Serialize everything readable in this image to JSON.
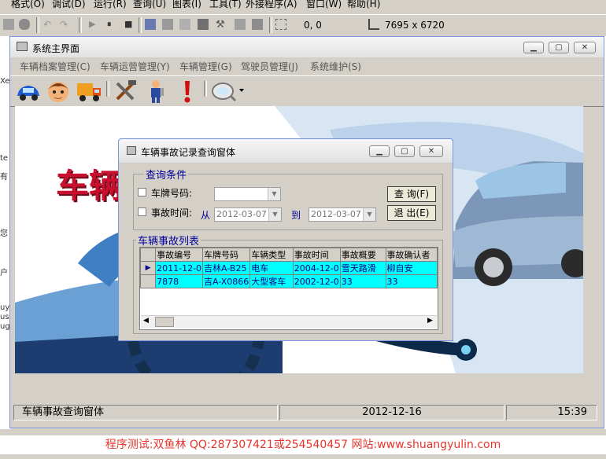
{
  "ide": {
    "menu": [
      "格式(O)",
      "调试(D)",
      "运行(R)",
      "查询(U)",
      "图表(I)",
      "工具(T)",
      "外接程序(A)",
      "窗口(W)",
      "帮助(H)"
    ],
    "position": "0, 0",
    "size": "7695 x 6720",
    "left_snippets": [
      "Xe",
      "te",
      "有",
      "您",
      "户",
      "uy",
      "us",
      "ug"
    ]
  },
  "main_window": {
    "title": "系统主界面",
    "menu": [
      "车辆档案管理(C)",
      "车辆运营管理(Y)",
      "车辆管理(G)",
      "驾驶员管理(J)",
      "系统维护(S)"
    ],
    "toolbar_icons": [
      "car-icon",
      "driver-avatar-icon",
      "truck-icon",
      "tools-icon",
      "mechanic-icon",
      "alert-icon",
      "search-magnifier-icon"
    ],
    "banner_text": "车辆",
    "status": {
      "form_name": "车辆事故查询窗体",
      "date": "2012-12-16",
      "time": "15:39"
    }
  },
  "dialog": {
    "title": "车辆事故记录查询窗体",
    "query_group_title": "查询条件",
    "plate_label": "车牌号码:",
    "plate_value": "",
    "time_label": "事故时间:",
    "from_label": "从",
    "to_label": "到",
    "date_from": "2012-03-07",
    "date_to": "2012-03-07",
    "query_button": "查 询(F)",
    "exit_button": "退 出(E)",
    "list_group_title": "车辆事故列表",
    "columns": [
      "事故编号",
      "车牌号码",
      "车辆类型",
      "事故时间",
      "事故概要",
      "事故确认者"
    ],
    "rows": [
      [
        "2011-12-0",
        "吉林A-B25",
        "电车",
        "2004-12-0",
        "雪天路滑",
        "柳自安"
      ],
      [
        "7878",
        "吉A-X0866",
        "大型客车",
        "2002-12-0",
        "33",
        "33"
      ]
    ]
  },
  "footer": "程序测试:双鱼林 QQ:287307421或254540457 网站:www.shuangyulin.com",
  "colors": {
    "grid_row": "#00ffff",
    "group_title": "#00009c",
    "footer": "#e8332a",
    "banner_text": "#c8102e"
  }
}
